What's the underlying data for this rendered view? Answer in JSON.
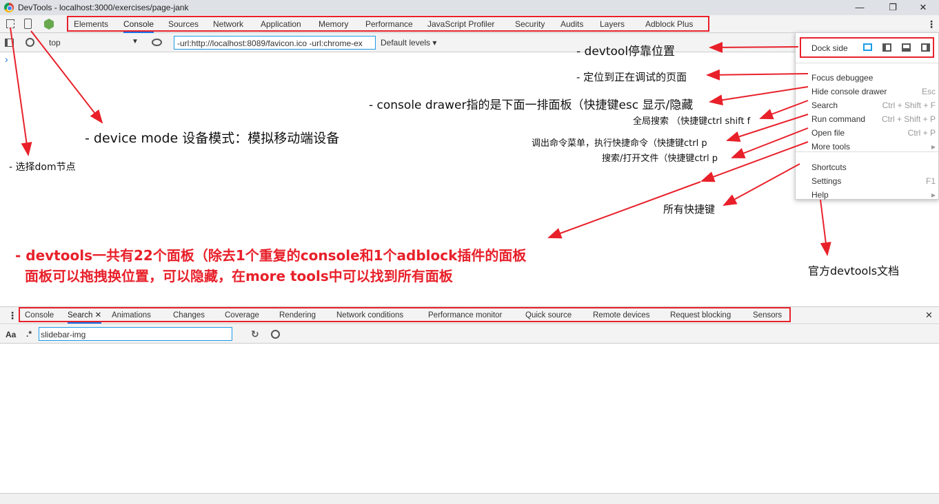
{
  "window": {
    "title": "DevTools - localhost:3000/exercises/page-jank",
    "minimize": "—",
    "restore": "❐",
    "close": "✕"
  },
  "main_tabs": [
    "Elements",
    "Console",
    "Sources",
    "Network",
    "Application",
    "Memory",
    "Performance",
    "JavaScript Profiler",
    "Security",
    "Audits",
    "Layers",
    "Adblock Plus"
  ],
  "selected_main_tab": "Console",
  "console_toolbar": {
    "context": "top",
    "filter_value": "-url:http://localhost:8089/favicon.ico -url:chrome-ex",
    "levels": "Default levels ▾",
    "prompt": "›"
  },
  "menu": {
    "dock_side": "Dock side",
    "items": [
      {
        "label": "Focus debuggee",
        "shortcut": ""
      },
      {
        "label": "Hide console drawer",
        "shortcut": "Esc"
      },
      {
        "label": "Search",
        "shortcut": "Ctrl + Shift + F"
      },
      {
        "label": "Run command",
        "shortcut": "Ctrl + Shift + P"
      },
      {
        "label": "Open file",
        "shortcut": "Ctrl + P"
      },
      {
        "label": "More tools",
        "shortcut": "▸"
      },
      {
        "label": "Shortcuts",
        "shortcut": ""
      },
      {
        "label": "Settings",
        "shortcut": "F1"
      },
      {
        "label": "Help",
        "shortcut": "▸"
      }
    ]
  },
  "drawer_tabs": [
    "Console",
    "Search",
    "Animations",
    "Changes",
    "Coverage",
    "Rendering",
    "Network conditions",
    "Performance monitor",
    "Quick source",
    "Remote devices",
    "Request blocking",
    "Sensors"
  ],
  "search": {
    "case_label": "Aa",
    "regex_label": ".*",
    "value": "slidebar-img"
  },
  "annotations": {
    "dock": "- devtool停靠位置",
    "focus": "- 定位到正在调试的页面",
    "drawer": "- console drawer指的是下面一排面板（快捷键esc 显示/隐藏",
    "search": "全局搜索 （快捷键ctrl shift f",
    "command": "调出命令菜单，执行快捷命令（快捷键ctrl p",
    "openfile": "搜索/打开文件（快捷键ctrl p",
    "shortcuts": "所有快捷键",
    "docs": "官方devtools文档",
    "device": "- device mode 设备模式：模拟移动端设备",
    "select": "- 选择dom节点",
    "panels1": "- devtools一共有22个面板（除去1个重复的console和1个adblock插件的面板",
    "panels2": "面板可以拖拽换位置，可以隐藏，在more tools中可以找到所有面板"
  },
  "colors": {
    "annotation": "#e8202a",
    "accent": "#1a73e8"
  }
}
